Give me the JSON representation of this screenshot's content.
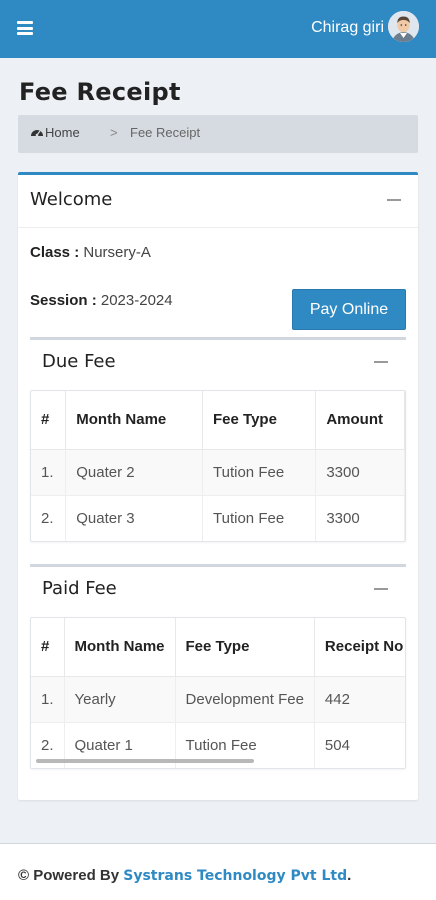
{
  "header": {
    "user_name": "Chirag giri"
  },
  "page": {
    "title": "Fee Receipt"
  },
  "breadcrumb": {
    "home": "Home",
    "separator": ">",
    "current": "Fee Receipt"
  },
  "welcome": {
    "title": "Welcome",
    "class_label": "Class :",
    "class_value": "Nursery-A",
    "session_label": "Session :",
    "session_value": "2023-2024",
    "pay_button": "Pay Online"
  },
  "due_fee": {
    "title": "Due Fee",
    "columns": [
      "#",
      "Month Name",
      "Fee Type",
      "Amount"
    ],
    "rows": [
      [
        "1.",
        "Quater 2",
        "Tution Fee",
        "3300"
      ],
      [
        "2.",
        "Quater 3",
        "Tution Fee",
        "3300"
      ]
    ]
  },
  "paid_fee": {
    "title": "Paid Fee",
    "columns": [
      "#",
      "Month Name",
      "Fee Type",
      "Receipt No"
    ],
    "rows": [
      [
        "1.",
        "Yearly",
        "Development Fee",
        "442"
      ],
      [
        "2.",
        "Quater 1",
        "Tution Fee",
        "504"
      ]
    ]
  },
  "footer": {
    "prefix": "© Powered By",
    "company": "Systrans Technology Pvt Ltd",
    "suffix": "."
  },
  "colors": {
    "primary": "#2f8ac4",
    "background": "#edf1f6"
  }
}
